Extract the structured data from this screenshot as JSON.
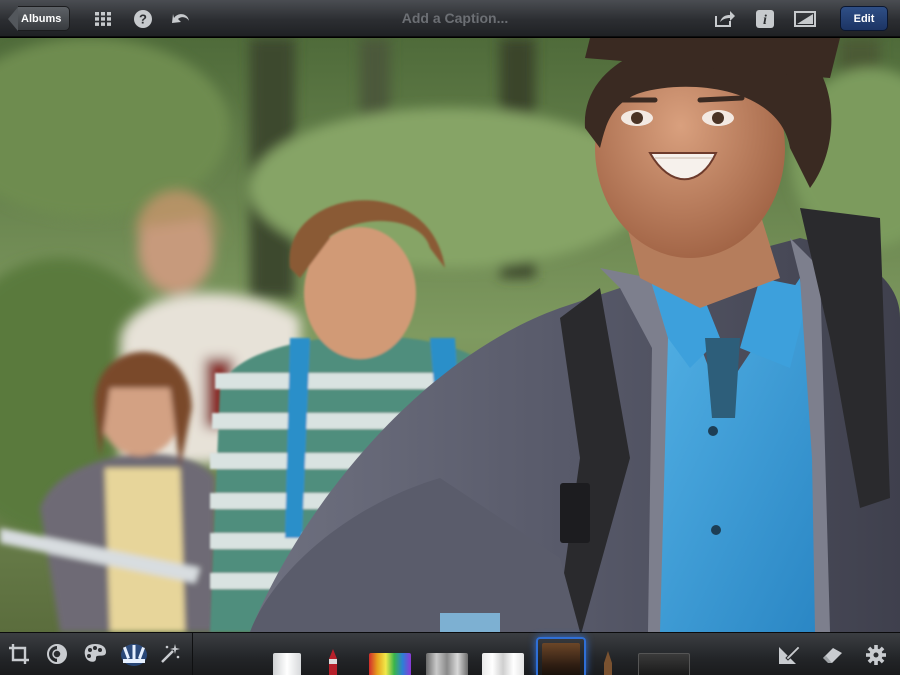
{
  "toolbar": {
    "back_label": "Albums",
    "caption_placeholder": "Add a Caption...",
    "edit_label": "Edit",
    "icons": [
      "grid-icon",
      "help-icon",
      "undo-icon",
      "share-icon",
      "info-icon",
      "compare-icon"
    ]
  },
  "tools": {
    "left": [
      "crop-icon",
      "exposure-icon",
      "color-icon",
      "brushes-icon",
      "effects-icon"
    ],
    "active_left": "brushes-icon",
    "brushes": [
      "white-brush",
      "red-brush",
      "saturate-brush",
      "desaturate-brush",
      "lighten-brush",
      "soften-brush",
      "sharpen-brush",
      "darken-brush"
    ],
    "active_brush": "soften-brush",
    "right": [
      "brush-settings-icon",
      "eraser-icon",
      "settings-icon"
    ]
  },
  "colors": {
    "accent": "#2f6fd6",
    "toolbar_dark": "#232528"
  }
}
